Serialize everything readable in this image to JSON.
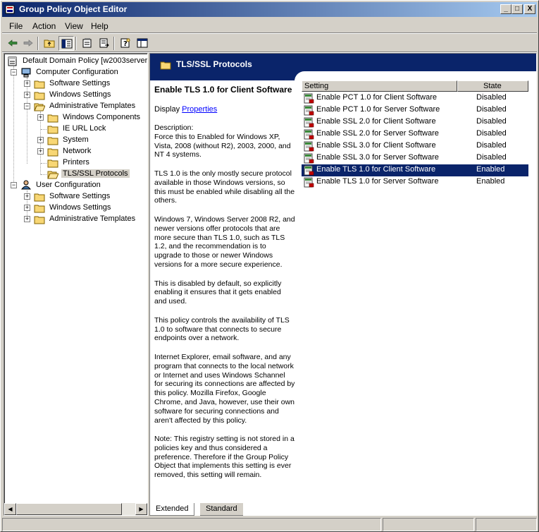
{
  "window": {
    "title": "Group Policy Object Editor",
    "controls": {
      "minimize": "_",
      "maximize": "□",
      "close": "X"
    }
  },
  "menu": {
    "file": "File",
    "action": "Action",
    "view": "View",
    "help": "Help"
  },
  "toolbar": {
    "icons": [
      "back-arrow-icon",
      "forward-arrow-icon",
      "up-folder-icon",
      "show-hide-tree-icon",
      "properties-icon",
      "export-list-icon",
      "help-icon",
      "console-view-icon"
    ]
  },
  "tree": {
    "root": "Default Domain Policy [w2003server.",
    "computer_config": "Computer Configuration",
    "cc_software": "Software Settings",
    "cc_windows": "Windows Settings",
    "cc_admin": "Administrative Templates",
    "windows_components": "Windows Components",
    "ie_url_lock": "IE URL Lock",
    "system": "System",
    "network": "Network",
    "printers": "Printers",
    "tls_ssl": "TLS/SSL Protocols",
    "user_config": "User Configuration",
    "uc_software": "Software Settings",
    "uc_windows": "Windows Settings",
    "uc_admin": "Administrative Templates",
    "expander_plus": "+",
    "expander_minus": "−"
  },
  "details": {
    "banner_title": "TLS/SSL Protocols",
    "selected_title": "Enable TLS 1.0 for Client Software",
    "display_label": "Display",
    "properties_link": "Properties",
    "paragraphs": [
      "Description:\nForce this to Enabled for Windows XP, Vista, 2008 (without R2), 2003, 2000, and NT 4 systems.",
      "TLS 1.0 is the only mostly secure protocol available in those Windows versions, so this must be enabled while disabling all the others.",
      "Windows 7, Windows Server 2008 R2, and newer versions offer protocols that are more secure than TLS 1.0, such as TLS 1.2, and the recommendation is to upgrade to those or newer Windows versions for a more secure experience.",
      "This is disabled by default, so explicitly enabling it ensures that it gets enabled and used.",
      "This policy controls the availability of TLS 1.0 to software that connects to secure endpoints over a network.",
      "Internet Explorer, email software, and any program that connects to the local network or Internet and uses Windows Schannel for securing its connections are affected by this policy. Mozilla Firefox, Google Chrome, and Java, however, use their own software for securing connections and aren't affected by this policy.",
      "Note:  This registry setting is not stored in a policies key and thus considered a preference.  Therefore if the Group Policy Object that implements this setting is ever removed, this setting will remain."
    ]
  },
  "list": {
    "col_setting": "Setting",
    "col_state": "State",
    "rows": [
      {
        "setting": "Enable PCT 1.0 for Client Software",
        "state": "Disabled"
      },
      {
        "setting": "Enable PCT 1.0 for Server Software",
        "state": "Disabled"
      },
      {
        "setting": "Enable SSL 2.0 for Client Software",
        "state": "Disabled"
      },
      {
        "setting": "Enable SSL 2.0 for Server Software",
        "state": "Disabled"
      },
      {
        "setting": "Enable SSL 3.0 for Client Software",
        "state": "Disabled"
      },
      {
        "setting": "Enable SSL 3.0 for Server Software",
        "state": "Disabled"
      },
      {
        "setting": "Enable TLS 1.0 for Client Software",
        "state": "Enabled",
        "selected": true
      },
      {
        "setting": "Enable TLS 1.0 for Server Software",
        "state": "Enabled"
      }
    ]
  },
  "tabs": {
    "extended": "Extended",
    "standard": "Standard"
  },
  "colors": {
    "selection": "#0a246a",
    "chrome": "#d4d0c8",
    "folder": "#f8d775"
  }
}
